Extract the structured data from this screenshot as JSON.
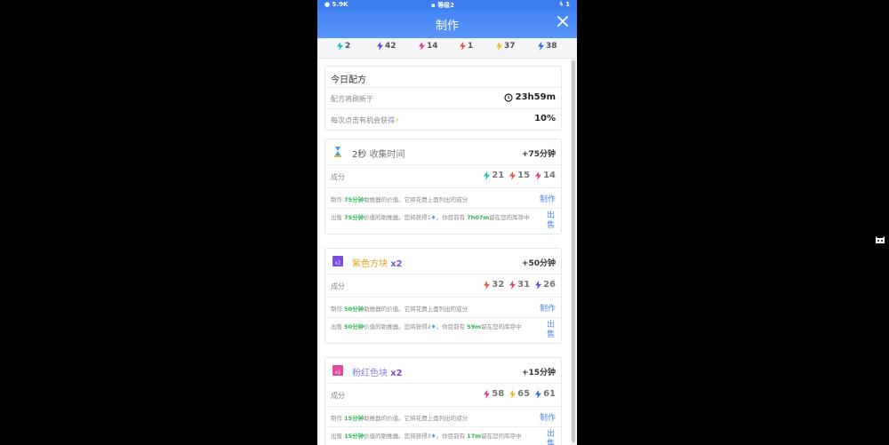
{
  "status": {
    "left": "5.9K",
    "center": "等级2",
    "right": "1"
  },
  "header": {
    "title": "制作"
  },
  "resources": [
    {
      "value": "2",
      "color": "#16c3c0"
    },
    {
      "value": "42",
      "color": "#6a4bd6"
    },
    {
      "value": "14",
      "color": "#e23d8a"
    },
    {
      "value": "1",
      "color": "#e8563f"
    },
    {
      "value": "37",
      "color": "#f5b623"
    },
    {
      "value": "38",
      "color": "#2d6fe0"
    }
  ],
  "today": {
    "title": "今日配方",
    "refresh_label": "配方将刷新于",
    "refresh_value": "23h59m",
    "chance_label": "每次点击有机会获得",
    "chance_value": "10%"
  },
  "recipes": [
    {
      "name_prefix": "2秒",
      "name": "收集时间",
      "name_suffix": "",
      "reward": "+75分钟",
      "components_label": "成分",
      "components": [
        {
          "value": "21",
          "color": "#16c3c0"
        },
        {
          "value": "15",
          "color": "#e8563f"
        },
        {
          "value": "14",
          "color": "#e23d8a"
        }
      ],
      "make_pre": "制作",
      "make_amount": "75分钟",
      "make_post": "助推器的价值。它将花费上面列出的成分",
      "make_action": "制作",
      "sell_pre": "出售",
      "sell_amount": "75分钟",
      "sell_mid": "价值的助推器。您将获得",
      "sell_gem": "1",
      "sell_mid2": "。你目前有",
      "sell_time": "7h07m",
      "sell_post": "留在您的库存中",
      "sell_action": "出售"
    },
    {
      "name_prefix": "",
      "name": "紫色方块",
      "name_suffix": "x2",
      "reward": "+50分钟",
      "components_label": "成分",
      "components": [
        {
          "value": "32",
          "color": "#e8563f"
        },
        {
          "value": "31",
          "color": "#e23d8a"
        },
        {
          "value": "26",
          "color": "#6a4bd6"
        }
      ],
      "make_pre": "制作",
      "make_amount": "50分钟",
      "make_post": "助推器的价值。它将花费上面列出的成分",
      "make_action": "制作",
      "sell_pre": "出售",
      "sell_amount": "50分钟",
      "sell_mid": "价值的助推器。您将获得",
      "sell_gem": "2",
      "sell_mid2": "。你目前有",
      "sell_time": "59m",
      "sell_post": "留在您的库存中",
      "sell_action": "出售"
    },
    {
      "name_prefix": "",
      "name": "粉红色块",
      "name_suffix": "x2",
      "reward": "+15分钟",
      "components_label": "成分",
      "components": [
        {
          "value": "58",
          "color": "#e23d8a"
        },
        {
          "value": "65",
          "color": "#f5b623"
        },
        {
          "value": "61",
          "color": "#2d6fe0"
        }
      ],
      "make_pre": "制作",
      "make_amount": "15分钟",
      "make_post": "助推器的价值。它将花费上面列出的成分",
      "make_action": "制作",
      "sell_pre": "出售",
      "sell_amount": "15分钟",
      "sell_mid": "价值的助推器。您将获得",
      "sell_gem": "3",
      "sell_mid2": "。你目前有",
      "sell_time": "17m",
      "sell_post": "留在您的库存中",
      "sell_action": "出售"
    }
  ],
  "colors": {
    "header": "#4384f5",
    "link": "#4a87f0",
    "highlight": "#2bb84c",
    "purple_block": "#7b4fe0",
    "pink_block": "#e24a9a"
  },
  "icons": [
    "bolt-icon",
    "close-icon",
    "clock-icon",
    "gem-icon",
    "hourglass-icon",
    "cat-icon"
  ]
}
